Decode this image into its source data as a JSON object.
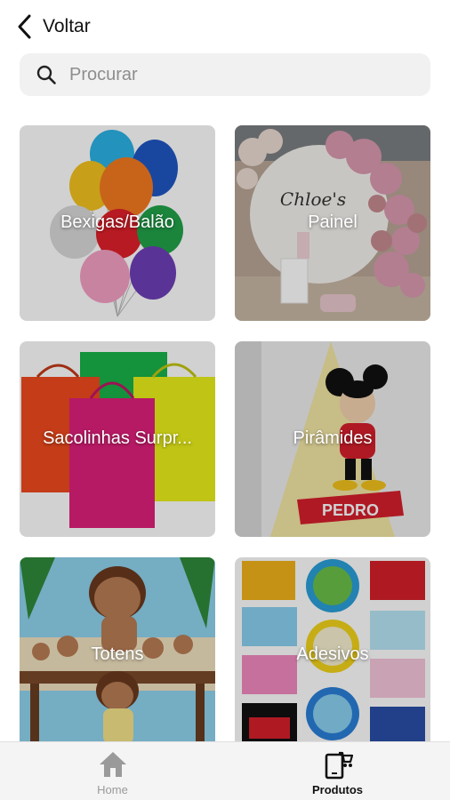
{
  "header": {
    "back_label": "Voltar"
  },
  "search": {
    "placeholder": "Procurar"
  },
  "categories": [
    {
      "label": "Bexigas/Balão"
    },
    {
      "label": "Painel"
    },
    {
      "label": "Sacolinhas Surpr..."
    },
    {
      "label": "Pirâmides"
    },
    {
      "label": "Totens"
    },
    {
      "label": "Adesivos"
    }
  ],
  "pyramid_banner_text": "PEDRO",
  "panel_script_text": "Chloe's",
  "tabbar": {
    "items": [
      {
        "label": "Home",
        "icon": "home-icon",
        "active": false
      },
      {
        "label": "Produtos",
        "icon": "products-icon",
        "active": true
      }
    ]
  },
  "colors": {
    "active_tab": "#111111",
    "inactive_tab": "#9a9a9a",
    "search_bg": "#f1f1f1"
  }
}
